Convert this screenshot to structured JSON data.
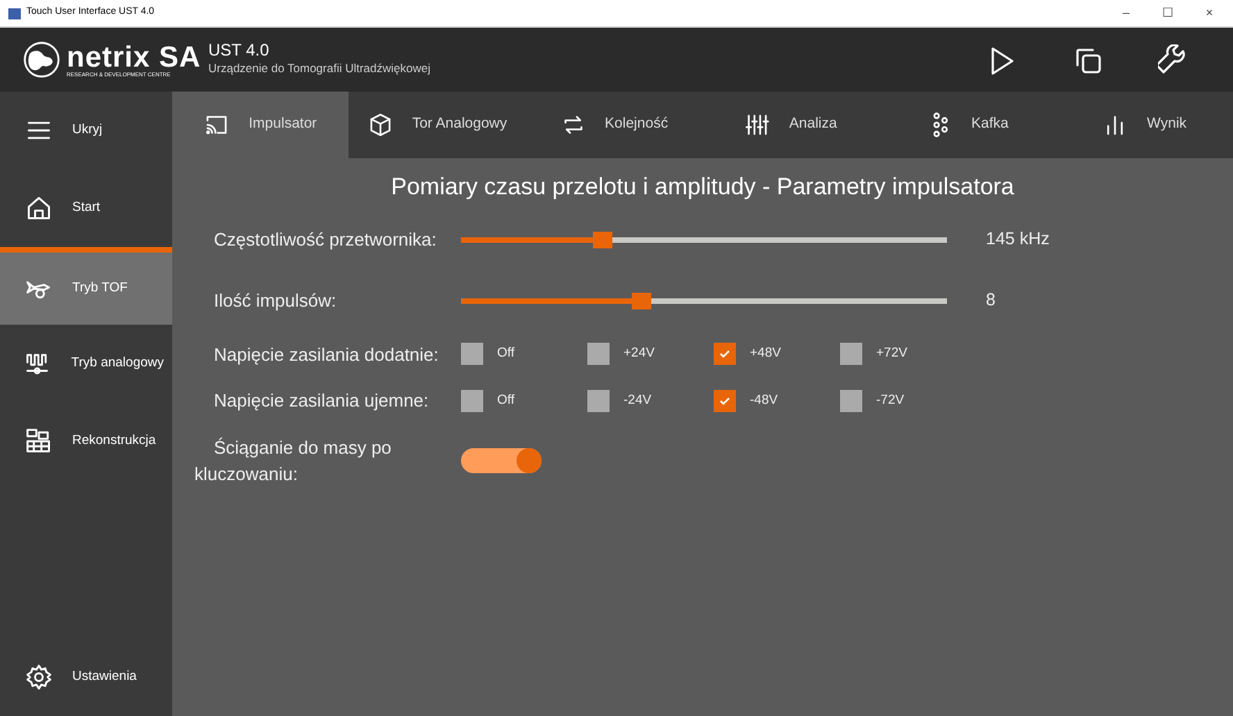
{
  "window": {
    "title": "Touch User Interface UST 4.0",
    "controls": [
      "–",
      "☐",
      "×"
    ]
  },
  "header": {
    "logo_name": "netrix SA",
    "logo_tagline": "RESEARCH & DEVELOPMENT CENTRE",
    "app_title": "UST 4.0",
    "app_subtitle": "Urządzenie do Tomografii Ultradźwiękowej",
    "actions": [
      {
        "kind": "play"
      },
      {
        "kind": "copy"
      },
      {
        "kind": "wrench"
      }
    ]
  },
  "sidebar": {
    "items": [
      {
        "label": "Ukryj",
        "kind": "menu",
        "selected": false
      },
      {
        "label": "Start",
        "kind": "home",
        "selected": false
      },
      {
        "label": "Tryb TOF",
        "kind": "tof",
        "selected": true
      },
      {
        "label": "Tryb analogowy",
        "kind": "wave",
        "selected": false
      },
      {
        "label": "Rekonstrukcja",
        "kind": "grid",
        "selected": false
      }
    ],
    "footer": {
      "label": "Ustawienia",
      "kind": "gear"
    }
  },
  "tabs": [
    {
      "label": "Impulsator",
      "kind": "cast",
      "selected": true
    },
    {
      "label": "Tor Analogowy",
      "kind": "cube",
      "selected": false
    },
    {
      "label": "Kolejność",
      "kind": "repeat",
      "selected": false
    },
    {
      "label": "Analiza",
      "kind": "sliders",
      "selected": false
    },
    {
      "label": "Kafka",
      "kind": "nodes",
      "selected": false
    },
    {
      "label": "Wynik",
      "kind": "bars",
      "selected": false
    }
  ],
  "content": {
    "title": "Pomiary czasu przelotu i amplitudy - Parametry impulsatora",
    "rows": [
      {
        "kind": "slider",
        "label": "Częstotliwość przetwornika:",
        "level": 0.29,
        "reading": "145 kHz"
      },
      {
        "kind": "slider",
        "label": "Ilość impulsów:",
        "level": 0.37,
        "reading": "8"
      },
      {
        "kind": "checks",
        "label": "Napięcie zasilania dodatnie:",
        "options": [
          {
            "label": "Off",
            "checked": false
          },
          {
            "label": "+24V",
            "checked": false
          },
          {
            "label": "+48V",
            "checked": true
          },
          {
            "label": "+72V",
            "checked": false
          }
        ]
      },
      {
        "kind": "checks",
        "label": "Napięcie zasilania ujemne:",
        "options": [
          {
            "label": "Off",
            "checked": false
          },
          {
            "label": "-24V",
            "checked": false
          },
          {
            "label": "-48V",
            "checked": true
          },
          {
            "label": "-72V",
            "checked": false
          }
        ]
      },
      {
        "kind": "toggle",
        "label": "Ściąganie do masy po kluczowaniu:",
        "on": true
      }
    ]
  }
}
